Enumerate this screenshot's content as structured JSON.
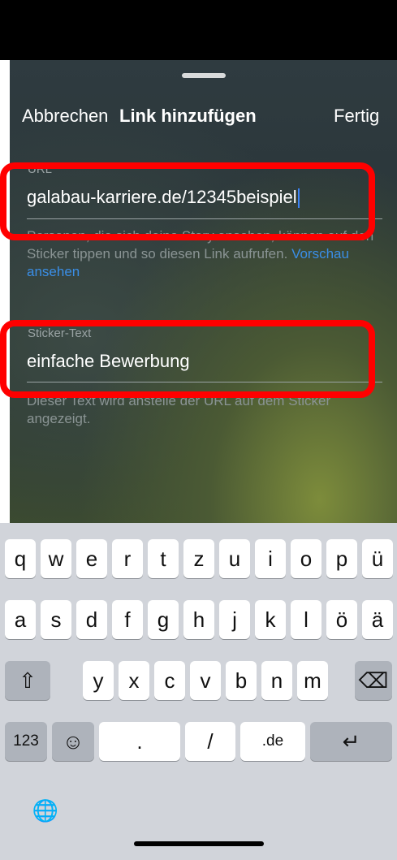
{
  "header": {
    "cancel": "Abbrechen",
    "title": "Link hinzufügen",
    "done": "Fertig"
  },
  "url_field": {
    "label": "URL",
    "value": "galabau-karriere.de/12345beispiel",
    "help": "Personen, die sich deine Story ansehen, können auf den Sticker tippen und so diesen Link aufrufen.",
    "preview_link": "Vorschau ansehen"
  },
  "sticker_field": {
    "label": "Sticker-Text",
    "value": "einfache Bewerbung",
    "help": "Dieser Text wird anstelle der URL auf dem Sticker angezeigt."
  },
  "highlight_color": "#ff0000",
  "keyboard": {
    "row1": [
      "q",
      "w",
      "e",
      "r",
      "t",
      "z",
      "u",
      "i",
      "o",
      "p",
      "ü"
    ],
    "row2": [
      "a",
      "s",
      "d",
      "f",
      "g",
      "h",
      "j",
      "k",
      "l",
      "ö",
      "ä"
    ],
    "row3": [
      "y",
      "x",
      "c",
      "v",
      "b",
      "n",
      "m"
    ],
    "shift_icon": "⇧",
    "delete_icon": "⌫",
    "numbers_key": "123",
    "emoji_icon": "☺",
    "period_key": ".",
    "slash_key": "/",
    "domain_key": ".de",
    "return_icon": "↵",
    "globe_icon": "🌐"
  }
}
